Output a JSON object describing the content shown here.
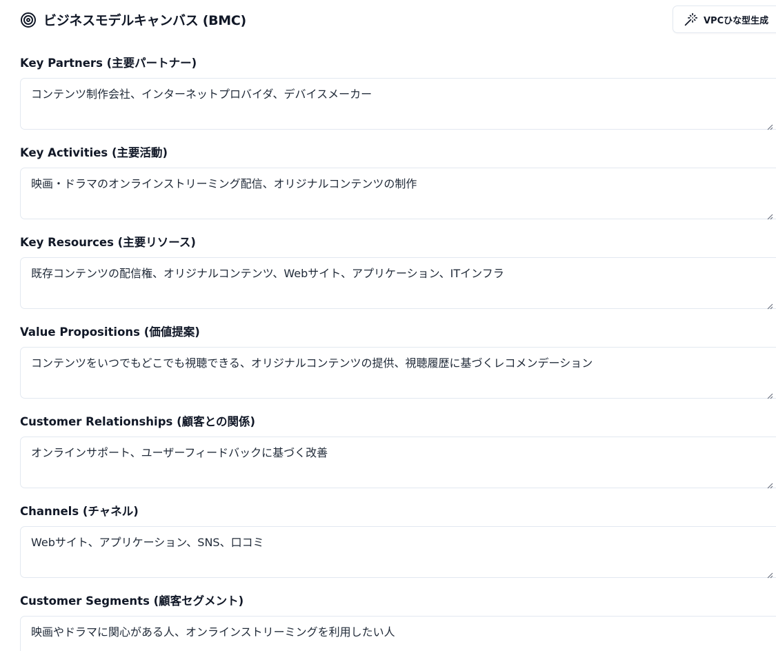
{
  "header": {
    "title": "ビジネスモデルキャンバス (BMC)",
    "title_icon": "target-icon",
    "vpc_button_label": "VPCひな型生成",
    "vpc_button_icon": "magic-wand-icon"
  },
  "fields": [
    {
      "label": "Key Partners (主要パートナー)",
      "value": "コンテンツ制作会社、インターネットプロバイダ、デバイスメーカー"
    },
    {
      "label": "Key Activities (主要活動)",
      "value": "映画・ドラマのオンラインストリーミング配信、オリジナルコンテンツの制作"
    },
    {
      "label": "Key Resources (主要リソース)",
      "value": "既存コンテンツの配信権、オリジナルコンテンツ、Webサイト、アプリケーション、ITインフラ"
    },
    {
      "label": "Value Propositions (価値提案)",
      "value": "コンテンツをいつでもどこでも視聴できる、オリジナルコンテンツの提供、視聴履歴に基づくレコメンデーション"
    },
    {
      "label": "Customer Relationships (顧客との関係)",
      "value": "オンラインサポート、ユーザーフィードバックに基づく改善"
    },
    {
      "label": "Channels (チャネル)",
      "value": "Webサイト、アプリケーション、SNS、口コミ"
    },
    {
      "label": "Customer Segments (顧客セグメント)",
      "value": "映画やドラマに関心がある人、オンラインストリーミングを利用したい人"
    }
  ],
  "colors": {
    "text": "#111827",
    "border": "#e2e8f0",
    "background": "#ffffff"
  }
}
